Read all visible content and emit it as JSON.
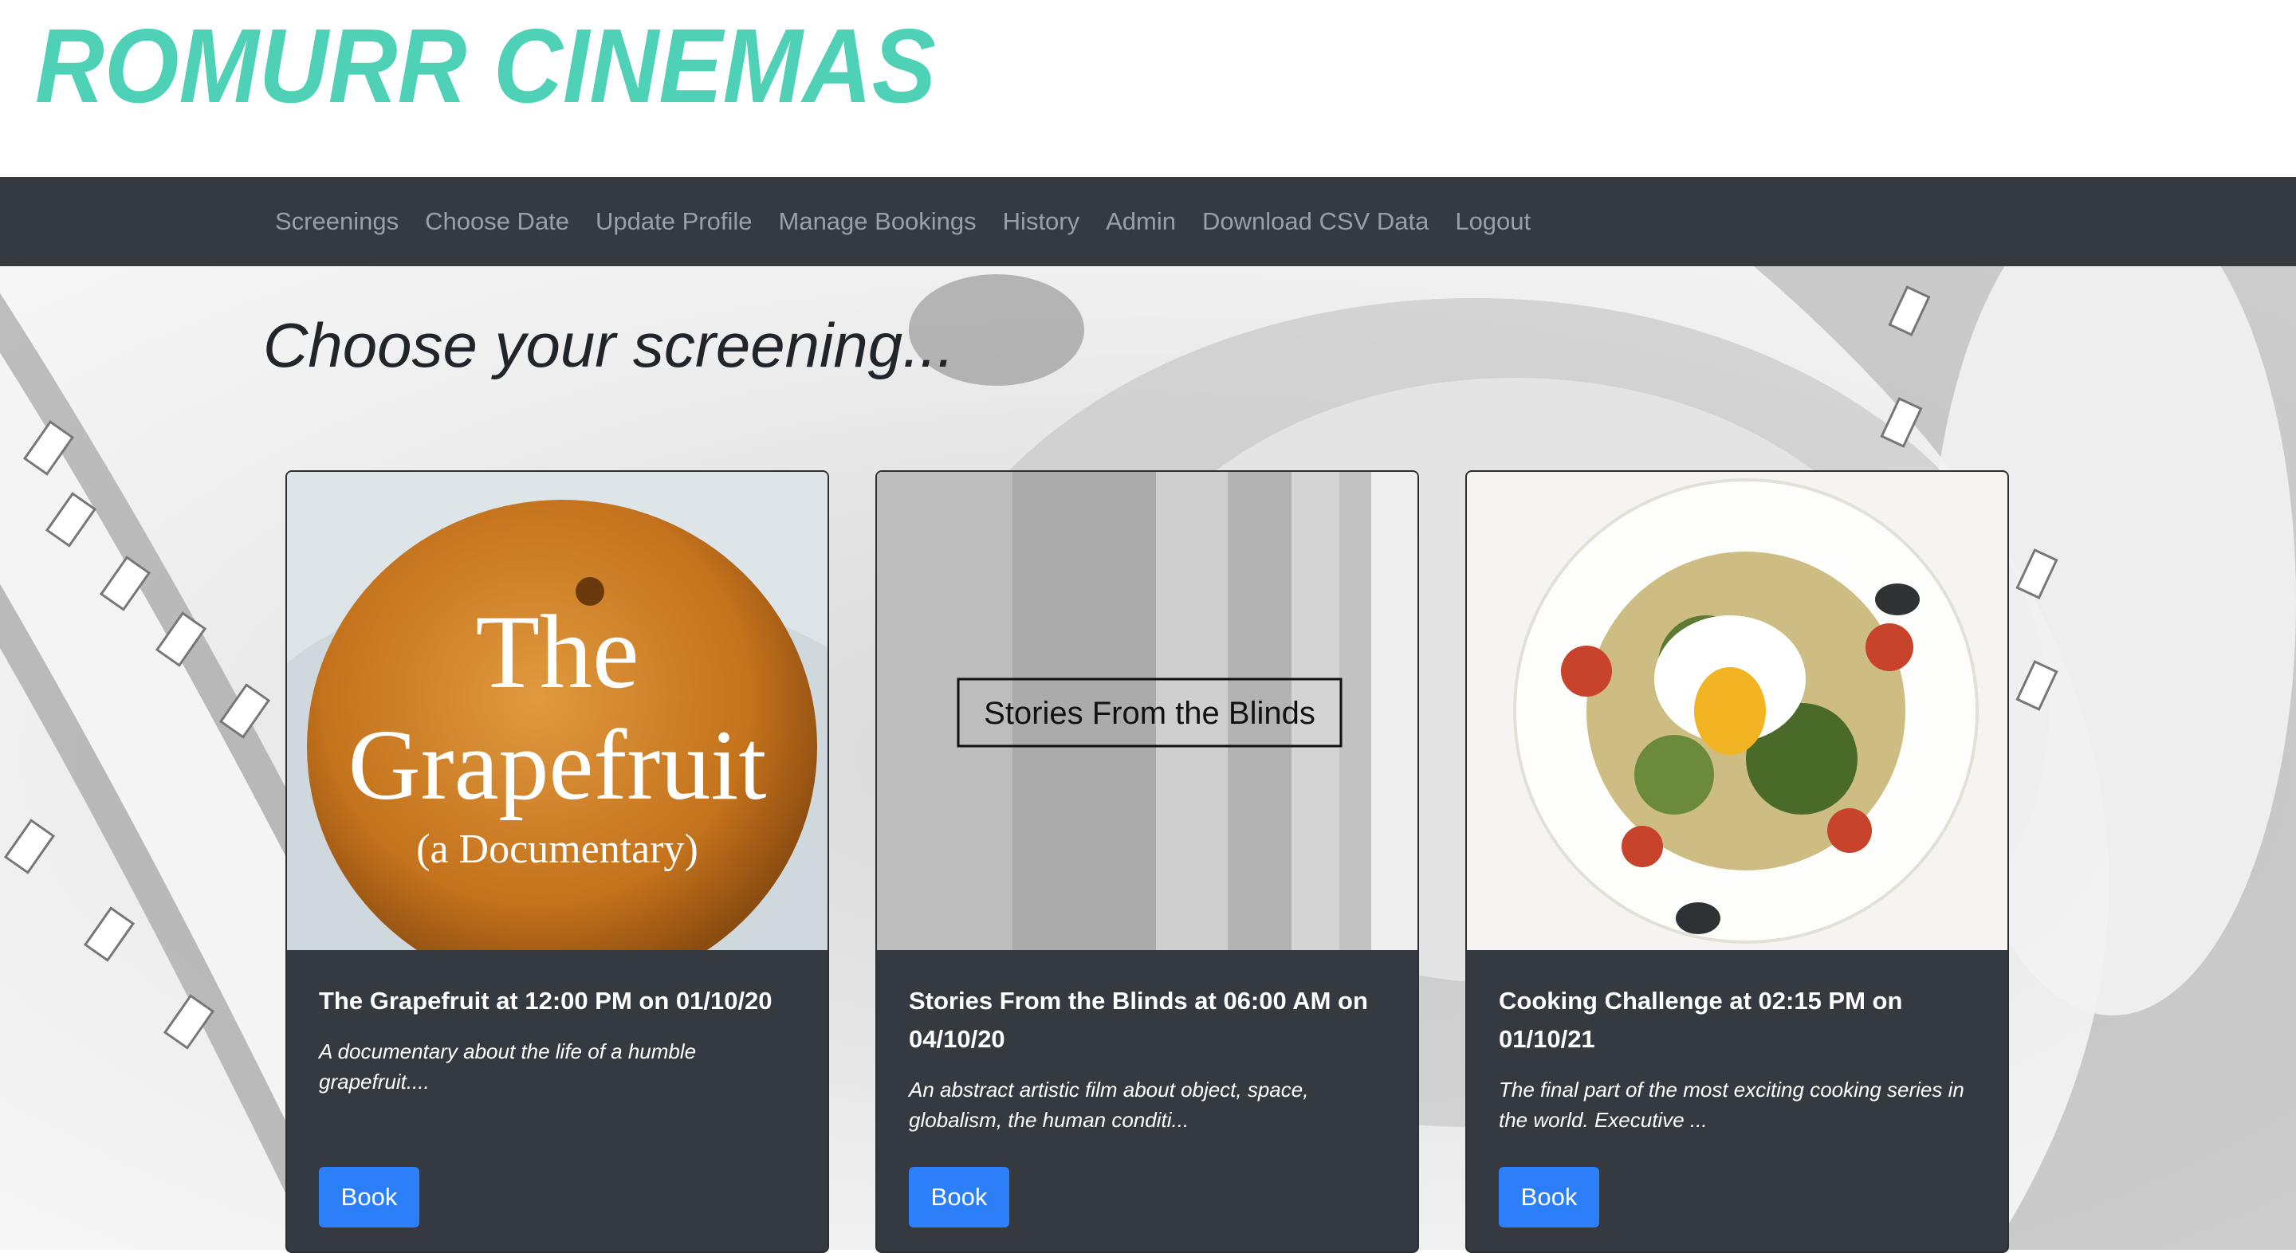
{
  "site": {
    "logo_text": "ROMURR CINEMAS",
    "accent_color": "#4fd1b8"
  },
  "nav": {
    "items": [
      {
        "label": "Screenings"
      },
      {
        "label": "Choose Date"
      },
      {
        "label": "Update Profile"
      },
      {
        "label": "Manage Bookings"
      },
      {
        "label": "History"
      },
      {
        "label": "Admin"
      },
      {
        "label": "Download CSV Data"
      },
      {
        "label": "Logout"
      }
    ]
  },
  "main": {
    "heading": "Choose your screening..."
  },
  "cards": [
    {
      "poster": {
        "title_line1": "The",
        "title_line2": "Grapefruit",
        "subtitle": "(a Documentary)"
      },
      "title": "The Grapefruit at 12:00 PM on 01/10/20",
      "description": "A documentary about the life of a humble grapefruit....",
      "button": "Book"
    },
    {
      "poster": {
        "title_line1": "Stories From the Blinds"
      },
      "title": "Stories From the Blinds at 06:00 AM on 04/10/20",
      "description": "An abstract artistic film about object, space, globalism, the human conditi...",
      "button": "Book"
    },
    {
      "poster": {},
      "title": "Cooking Challenge at 02:15 PM on 01/10/21",
      "description": "The final part of the most exciting cooking series in the world. Executive ...",
      "button": "Book"
    }
  ],
  "colors": {
    "navbar": "#343a40",
    "card": "#343a40",
    "button": "#2d7ff9"
  }
}
